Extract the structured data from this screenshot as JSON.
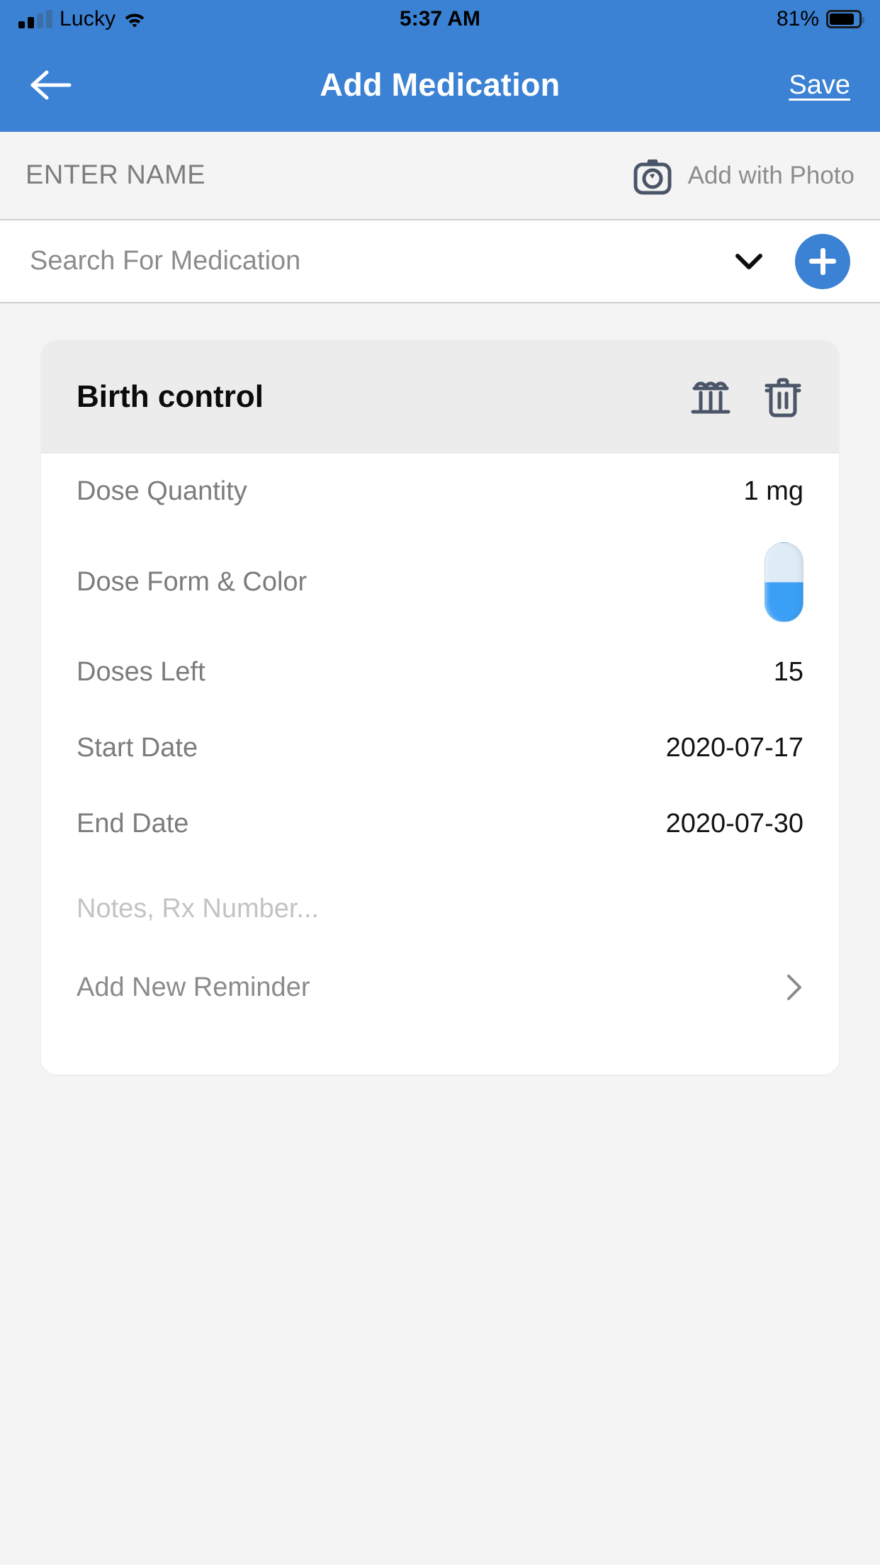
{
  "status_bar": {
    "carrier": "Lucky",
    "time": "5:37 AM",
    "battery_percent": "81%",
    "signal_icon": "signal-bars-icon",
    "wifi_icon": "wifi-icon",
    "battery_icon": "battery-icon"
  },
  "nav": {
    "back_icon": "back-arrow-icon",
    "title": "Add Medication",
    "save_label": "Save"
  },
  "name_section": {
    "enter_name_placeholder": "ENTER NAME",
    "camera_icon": "camera-icon",
    "add_with_photo_label": "Add with Photo"
  },
  "search_section": {
    "placeholder": "Search For Medication",
    "chevron_icon": "chevron-down-icon",
    "add_icon": "plus-icon"
  },
  "medication_card": {
    "title": "Birth control",
    "archive_icon": "pillar-icon",
    "delete_icon": "trash-icon",
    "rows": [
      {
        "label": "Dose Quantity",
        "value": "1  mg"
      },
      {
        "label": "Dose Form & Color",
        "value": ""
      },
      {
        "label": "Doses Left",
        "value": "15"
      },
      {
        "label": "Start Date",
        "value": "2020-07-17"
      },
      {
        "label": "End Date",
        "value": "2020-07-30"
      }
    ],
    "pill_icon": "capsule-pill-icon",
    "pill_top_color": "#dfebf7",
    "pill_bottom_color": "#3aa0f5",
    "notes_placeholder": "Notes, Rx Number...",
    "reminder_label": "Add New Reminder",
    "reminder_chevron_icon": "chevron-right-icon"
  },
  "colors": {
    "brand_blue": "#3b82d4",
    "page_background": "#f4f4f4",
    "card_header": "#ececec",
    "icon_slate": "#4a5568"
  }
}
